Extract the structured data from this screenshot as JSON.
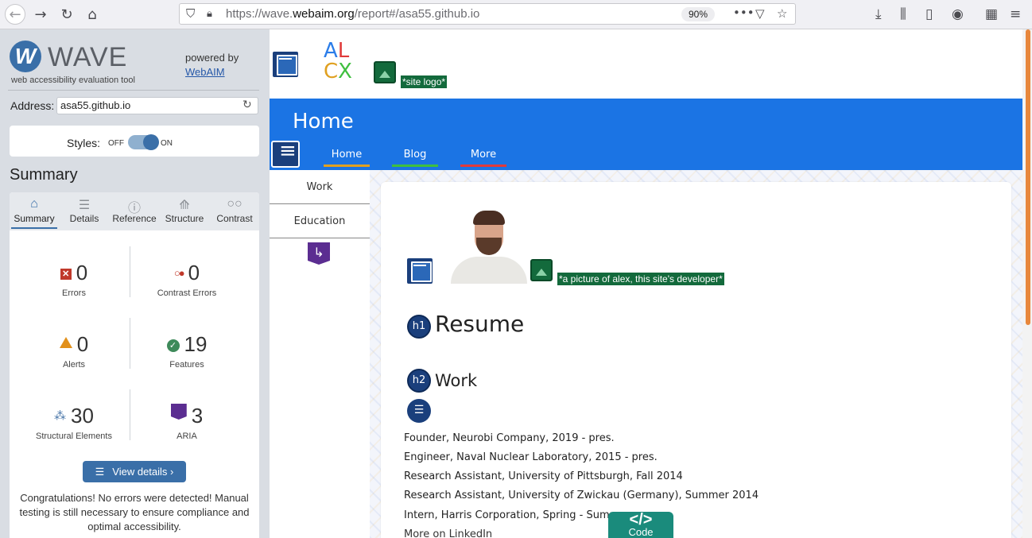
{
  "browser": {
    "url_prefix": "https://wave.",
    "url_domain": "webaim.org",
    "url_path": "/report#/asa55.github.io",
    "zoom": "90%"
  },
  "wave": {
    "logo_letter": "W",
    "brand": "WAVE",
    "tagline": "web accessibility evaluation tool",
    "powered_by": "powered by",
    "webaim_link": "WebAIM",
    "address_label": "Address:",
    "address_value": "asa55.github.io",
    "styles_label": "Styles:",
    "styles_off": "OFF",
    "styles_on": "ON",
    "summary_title": "Summary",
    "tabs": [
      {
        "label": "Summary",
        "icon": "home-icon"
      },
      {
        "label": "Details",
        "icon": "list-icon"
      },
      {
        "label": "Reference",
        "icon": "info-icon"
      },
      {
        "label": "Structure",
        "icon": "hierarchy-icon"
      },
      {
        "label": "Contrast",
        "icon": "contrast-icon"
      }
    ],
    "stats": {
      "errors": {
        "value": "0",
        "label": "Errors"
      },
      "contrast_errors": {
        "value": "0",
        "label": "Contrast Errors"
      },
      "alerts": {
        "value": "0",
        "label": "Alerts"
      },
      "features": {
        "value": "19",
        "label": "Features"
      },
      "structural": {
        "value": "30",
        "label": "Structural Elements"
      },
      "aria": {
        "value": "3",
        "label": "ARIA"
      }
    },
    "view_details": "View details ›",
    "congrats": "Congratulations! No errors were detected! Manual testing is still necessary to ensure compliance and optimal accessibility.",
    "colors": {
      "accent": "#3a6fa8",
      "error": "#c0392b",
      "alert": "#e2901a",
      "feature": "#3e8a5a",
      "aria": "#5b2d91"
    }
  },
  "site": {
    "logo_alt": "*site logo*",
    "logo_letters": [
      "A",
      "L",
      "C",
      "X"
    ],
    "banner_title": "Home",
    "nav": [
      {
        "label": "Home",
        "underline": "#e0a020"
      },
      {
        "label": "Blog",
        "underline": "#3fbf3f"
      },
      {
        "label": "More",
        "underline": "#e03a3a"
      }
    ],
    "subnav": [
      "Work",
      "Education"
    ],
    "photo_alt": "*a picture of alex, this site's developer*",
    "h1_badge": "h1",
    "h1": "Resume",
    "h2_badge": "h2",
    "h2": "Work",
    "work_items": [
      "Founder, Neurobi Company, 2019 - pres.",
      "Engineer, Naval Nuclear Laboratory, 2015 - pres.",
      "Research Assistant, University of Pittsburgh, Fall 2014",
      "Research Assistant, University of Zwickau (Germany), Summer 2014",
      "Intern, Harris Corporation, Spring - Summ"
    ],
    "linkedin": "More on LinkedIn",
    "colors": {
      "banner": "#1b74e4"
    }
  },
  "code_tab": {
    "icon": "</>",
    "label": "Code"
  }
}
